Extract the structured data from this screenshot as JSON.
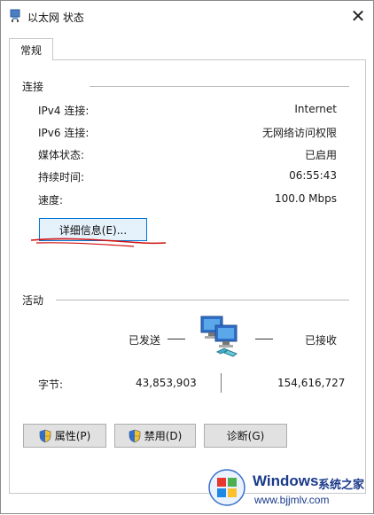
{
  "window": {
    "title": "以太网 状态",
    "close_label": "✕"
  },
  "tab": {
    "label": "常规"
  },
  "connection": {
    "group_label": "连接",
    "rows": [
      {
        "label": "IPv4 连接:",
        "value": "Internet"
      },
      {
        "label": "IPv6 连接:",
        "value": "无网络访问权限"
      },
      {
        "label": "媒体状态:",
        "value": "已启用"
      },
      {
        "label": "持续时间:",
        "value": "06:55:43"
      },
      {
        "label": "速度:",
        "value": "100.0 Mbps"
      }
    ],
    "details_button": "详细信息(E)..."
  },
  "activity": {
    "group_label": "活动",
    "sent_label": "已发送",
    "received_label": "已接收",
    "bytes_label": "字节:",
    "bytes_sent": "43,853,903",
    "bytes_received": "154,616,727"
  },
  "buttons": {
    "properties": "属性(P)",
    "disable": "禁用(D)",
    "diagnose": "诊断(G)"
  },
  "watermark": {
    "brand": "Windows",
    "brand_suffix": "系统之家",
    "url": "www.bjjmlv.com"
  },
  "colors": {
    "accent": "#0078d7",
    "annotation_underline": "#d01010"
  }
}
